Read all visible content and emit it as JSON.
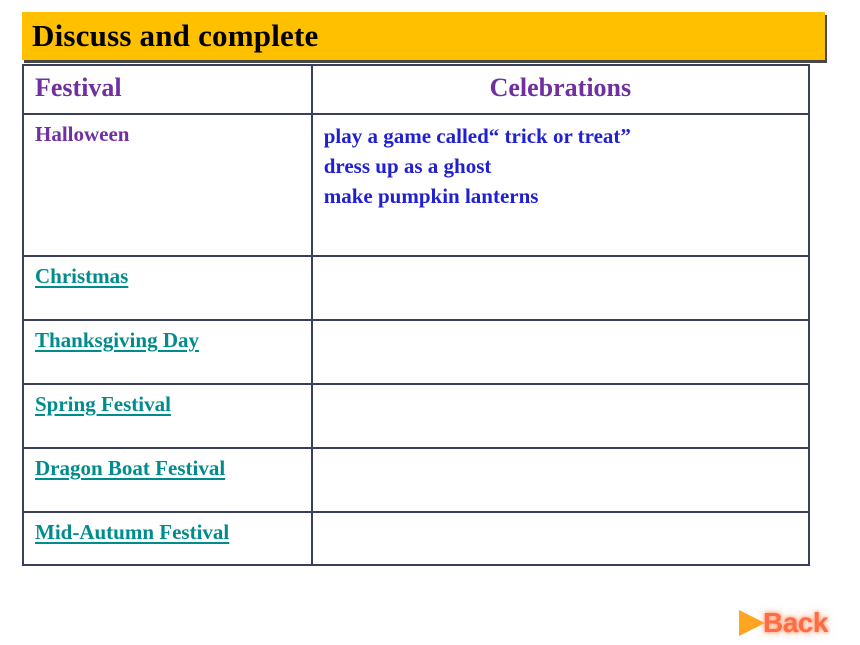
{
  "slide": {
    "title": "Discuss and complete",
    "banner_color": "#FFC000",
    "title_color": "#000000"
  },
  "table": {
    "border_color": "#3A3F5C",
    "header_color": "#7030A0",
    "link_color": "#008C8C",
    "answer_color": "#2020D0",
    "columns": [
      {
        "label": "Festival",
        "align": "left"
      },
      {
        "label": "Celebrations",
        "align": "center"
      }
    ],
    "rows": [
      {
        "festival": "Halloween",
        "is_link": false,
        "celebrations": [
          "play a game called“ trick or treat”",
          "dress up as a ghost",
          "make pumpkin lanterns"
        ]
      },
      {
        "festival": "Christmas",
        "is_link": true,
        "celebrations": []
      },
      {
        "festival": "Thanksgiving Day",
        "is_link": true,
        "celebrations": []
      },
      {
        "festival": "Spring Festival",
        "is_link": true,
        "celebrations": []
      },
      {
        "festival": "Dragon Boat Festival",
        "is_link": true,
        "celebrations": []
      },
      {
        "festival": "Mid-Autumn Festival",
        "is_link": true,
        "celebrations": []
      }
    ]
  },
  "navigation": {
    "back_label": "Back",
    "back_icon": "triangle-right-icon",
    "arrow_color": "#FFA51F",
    "label_color": "#FF6B42"
  }
}
